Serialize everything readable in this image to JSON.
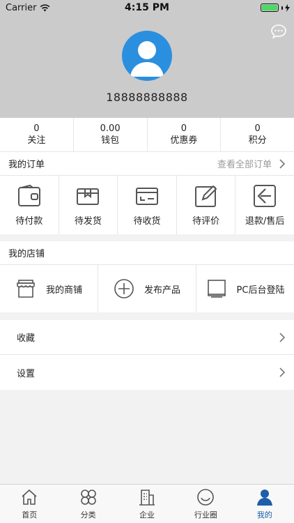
{
  "status_bar": {
    "carrier": "Carrier",
    "time": "4:15 PM"
  },
  "profile": {
    "phone": "18888888888"
  },
  "stats": [
    {
      "value": "0",
      "label": "关注"
    },
    {
      "value": "0.00",
      "label": "钱包"
    },
    {
      "value": "0",
      "label": "优惠券"
    },
    {
      "value": "0",
      "label": "积分"
    }
  ],
  "orders": {
    "title": "我的订单",
    "view_all": "查看全部订单",
    "items": [
      {
        "label": "待付款",
        "icon": "wallet-icon"
      },
      {
        "label": "待发货",
        "icon": "package-icon"
      },
      {
        "label": "待收货",
        "icon": "card-icon"
      },
      {
        "label": "待评价",
        "icon": "edit-icon"
      },
      {
        "label": "退款/售后",
        "icon": "return-icon"
      }
    ]
  },
  "shop": {
    "title": "我的店铺",
    "items": [
      {
        "label": "我的商铺",
        "icon": "store-icon"
      },
      {
        "label": "发布产品",
        "icon": "plus-circle-icon"
      },
      {
        "label": "PC后台登陆",
        "icon": "monitor-icon"
      }
    ]
  },
  "menu": [
    {
      "label": "收藏"
    },
    {
      "label": "设置"
    }
  ],
  "tabbar": [
    {
      "label": "首页",
      "icon": "home-icon"
    },
    {
      "label": "分类",
      "icon": "category-icon"
    },
    {
      "label": "企业",
      "icon": "building-icon"
    },
    {
      "label": "行业圈",
      "icon": "smile-icon"
    },
    {
      "label": "我的",
      "icon": "user-icon",
      "active": true
    }
  ],
  "colors": {
    "accent": "#1d5fa8",
    "avatar": "#2b8fdf",
    "header_bg": "#cbcbcb",
    "battery": "#4cd964"
  }
}
